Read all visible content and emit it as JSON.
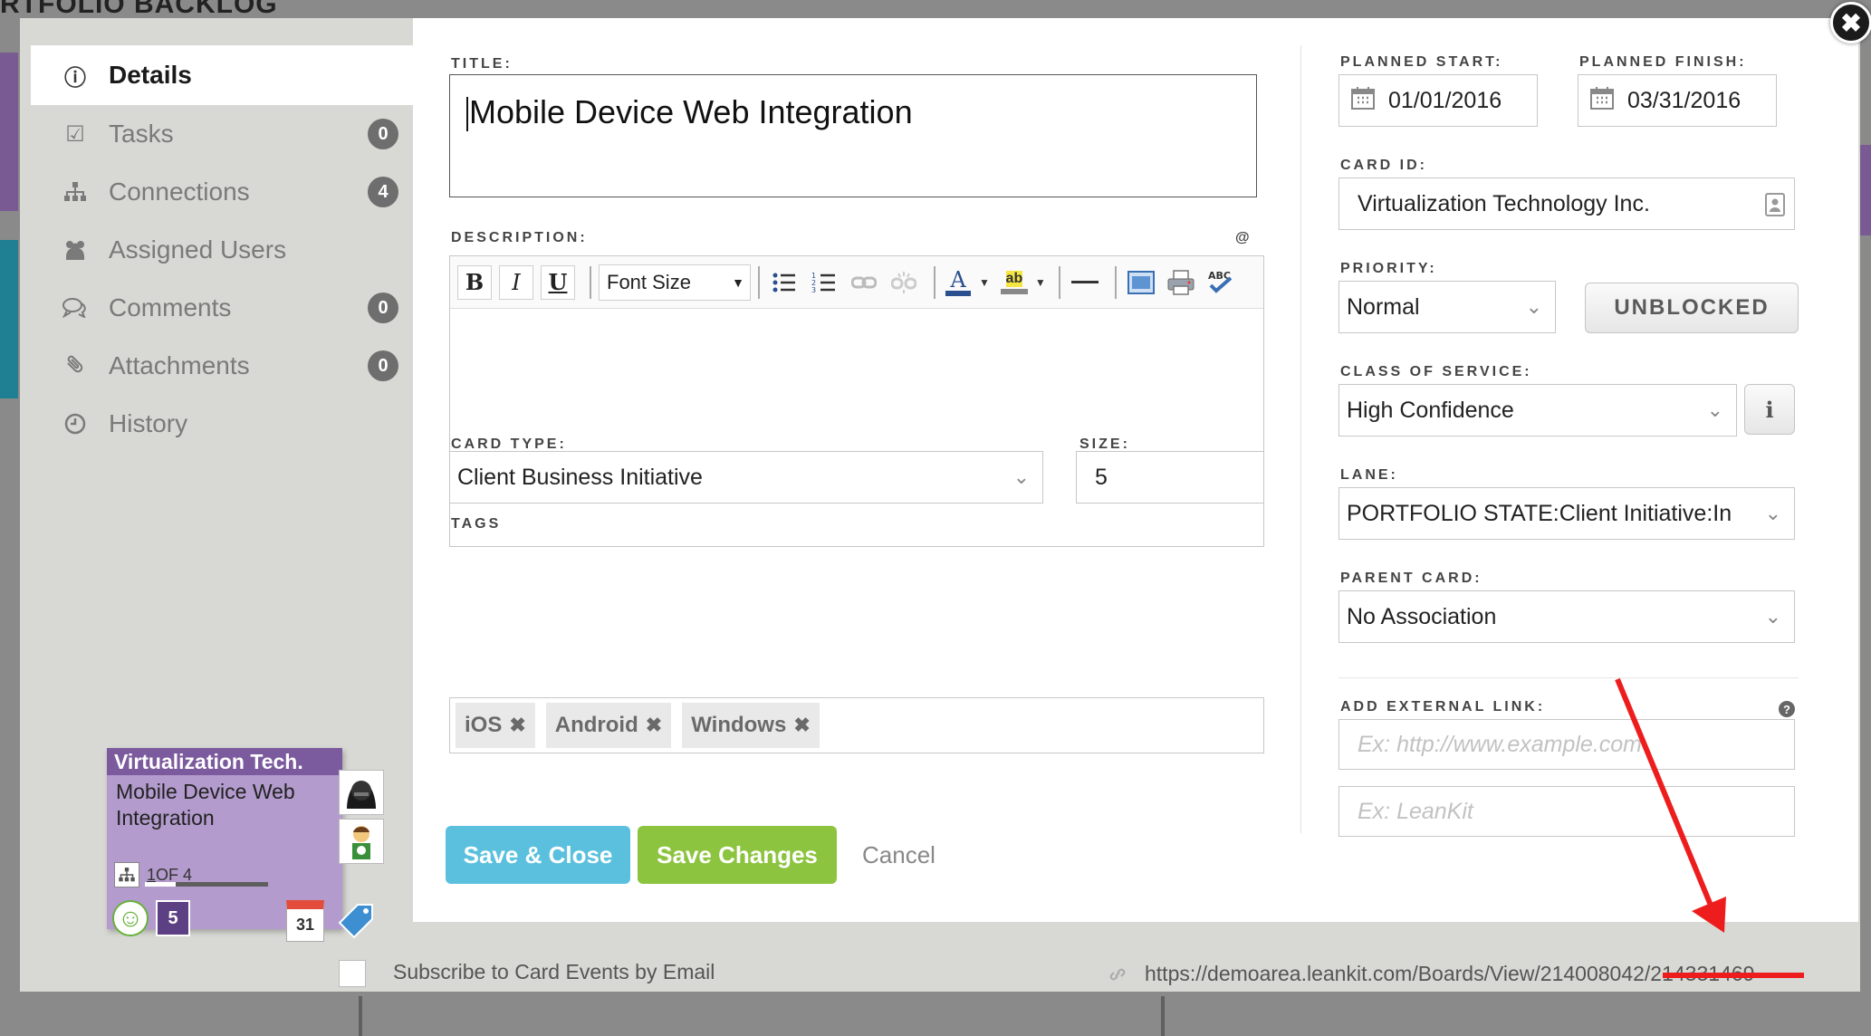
{
  "background": {
    "board_title": "RTFOLIO BACKLOG"
  },
  "sidebar": {
    "items": [
      {
        "label": "Details",
        "icon": "info-icon",
        "count": null
      },
      {
        "label": "Tasks",
        "icon": "checkbox-icon",
        "count": "0"
      },
      {
        "label": "Connections",
        "icon": "hierarchy-icon",
        "count": "4"
      },
      {
        "label": "Assigned Users",
        "icon": "users-icon",
        "count": null
      },
      {
        "label": "Comments",
        "icon": "comments-icon",
        "count": "0"
      },
      {
        "label": "Attachments",
        "icon": "paperclip-icon",
        "count": "0"
      },
      {
        "label": "History",
        "icon": "clock-icon",
        "count": null
      }
    ]
  },
  "card_preview": {
    "header": "Virtualization Tech.",
    "title": "Mobile Device Web Integration",
    "progress_prefix": "1",
    "progress_text": " OF 4",
    "progress_fraction": 0.25,
    "size": "5",
    "calendar_day": "31"
  },
  "form": {
    "title_label": "TITLE:",
    "title_value": "Mobile Device Web Integration",
    "description_label": "DESCRIPTION:",
    "description_at": "@",
    "font_size_label": "Font Size",
    "card_type_label": "CARD TYPE:",
    "card_type_value": "Client Business Initiative",
    "size_label": "SIZE:",
    "size_value": "5",
    "tags_label": "TAGS",
    "tags": [
      "iOS",
      "Android",
      "Windows"
    ],
    "planned_start_label": "PLANNED START:",
    "planned_start_value": "01/01/2016",
    "planned_finish_label": "PLANNED FINISH:",
    "planned_finish_value": "03/31/2016",
    "card_id_label": "CARD ID:",
    "card_id_value": "Virtualization Technology Inc.",
    "priority_label": "PRIORITY:",
    "priority_value": "Normal",
    "unblocked_label": "UNBLOCKED",
    "class_of_service_label": "CLASS OF SERVICE:",
    "class_of_service_value": "High Confidence",
    "lane_label": "LANE:",
    "lane_value": "PORTFOLIO STATE:Client Initiative:In",
    "parent_card_label": "PARENT CARD:",
    "parent_card_value": "No Association",
    "external_link_label": "ADD EXTERNAL LINK:",
    "external_url_placeholder": "Ex: http://www.example.com",
    "external_name_placeholder": "Ex: LeanKit"
  },
  "actions": {
    "save_close": "Save & Close",
    "save_changes": "Save Changes",
    "cancel": "Cancel"
  },
  "footer": {
    "subscribe_label": "Subscribe to Card Events by Email",
    "card_url": "https://demoarea.leankit.com/Boards/View/214008042/214331469"
  },
  "colors": {
    "save_close": "#5bc0de",
    "save_changes": "#8cc43f",
    "card_header": "#7b5a9d",
    "annotation": "#ee1d1d"
  }
}
